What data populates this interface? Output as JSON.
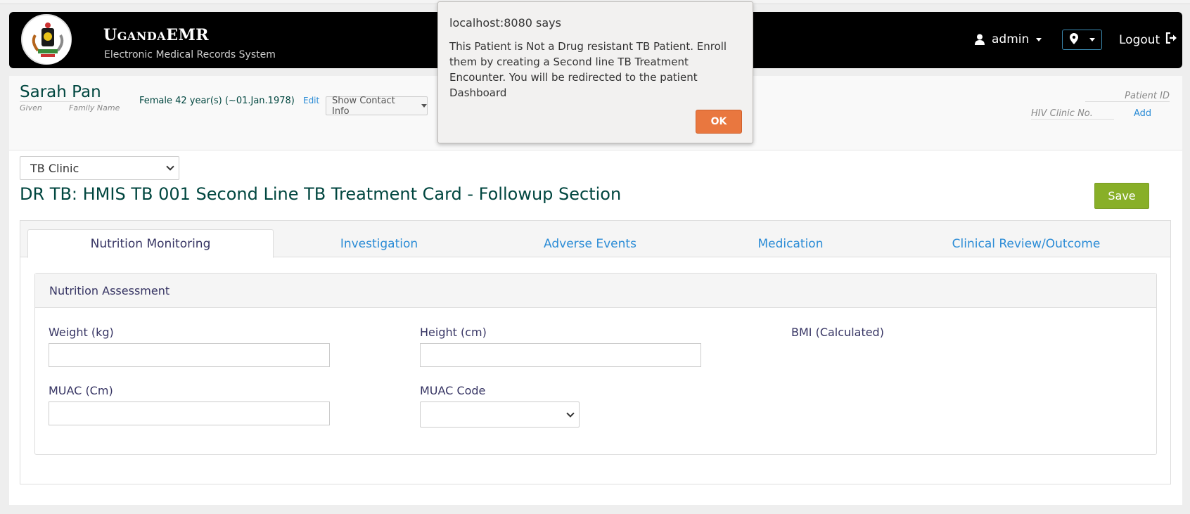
{
  "header": {
    "brand_title_u": "U",
    "brand_title_ganda": "GANDA",
    "brand_title_emr": "EMR",
    "brand_subtitle": "Electronic Medical Records System",
    "user_label": "admin",
    "logout_label": "Logout"
  },
  "patient": {
    "name": "Sarah Pan",
    "given_label": "Given",
    "family_label": "Family Name",
    "info": "Female  42 year(s) (~01.Jan.1978)",
    "edit_label": "Edit",
    "contact_button": "Show Contact Info",
    "patient_id_label": "Patient ID",
    "hiv_clinic_label": "HIV Clinic No.",
    "add_label": "Add"
  },
  "form": {
    "clinic_selected": "TB Clinic",
    "title": "DR TB: HMIS TB 001 Second Line TB Treatment Card - Followup Section",
    "save_label": "Save",
    "tabs": [
      {
        "label": "Nutrition Monitoring"
      },
      {
        "label": "Investigation"
      },
      {
        "label": "Adverse Events"
      },
      {
        "label": "Medication"
      },
      {
        "label": "Clinical Review/Outcome"
      }
    ],
    "section_title": "Nutrition Assessment",
    "weight_label": "Weight (kg)",
    "height_label": "Height (cm)",
    "bmi_label": "BMI (Calculated)",
    "muac_label": "MUAC (Cm)",
    "muac_code_label": "MUAC Code"
  },
  "dialog": {
    "title": "localhost:8080 says",
    "message": "This Patient is Not a Drug resistant TB Patient. Enroll them by creating a Second line TB Treatment Encounter. You will be redirected to the patient Dashboard",
    "ok_label": "OK"
  },
  "colors": {
    "header_bg": "#000000",
    "accent_green": "#00463f",
    "link_blue": "#2b8cd6",
    "save_green": "#88af28",
    "ok_orange": "#e9773f"
  }
}
